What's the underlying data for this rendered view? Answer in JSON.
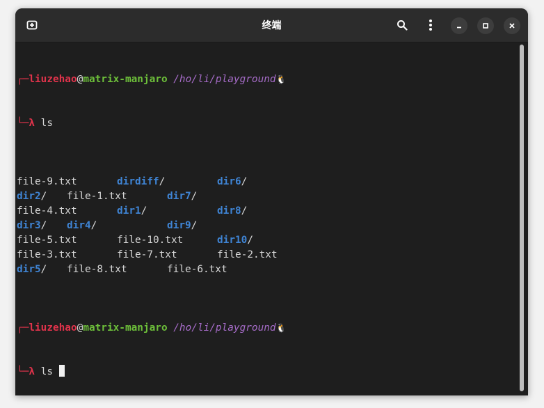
{
  "window": {
    "title": "终端"
  },
  "prompt": {
    "corner_top": "┌─",
    "corner_bottom": "└─",
    "user": "liuzehao",
    "at": "@",
    "host": "matrix-manjaro",
    "path": " /ho/li/playground",
    "penguin": "🐧",
    "lambda": "λ",
    "command": " ls"
  },
  "listing": [
    [
      {
        "text": "file-9.txt",
        "dir": false
      },
      {
        "text": "dirdiff",
        "dir": true
      },
      {
        "text": "dir6",
        "dir": true
      }
    ],
    [
      {
        "text": "dir2",
        "dir": true
      },
      {
        "text": "file-1.txt",
        "dir": false
      },
      {
        "text": "dir7",
        "dir": true
      }
    ],
    [
      {
        "text": "file-4.txt",
        "dir": false
      },
      {
        "text": "dir1",
        "dir": true
      },
      {
        "text": "dir8",
        "dir": true
      }
    ],
    [
      {
        "text": "dir3",
        "dir": true
      },
      {
        "text": "dir4",
        "dir": true
      },
      {
        "text": "dir9",
        "dir": true
      }
    ],
    [
      {
        "text": "file-5.txt",
        "dir": false
      },
      {
        "text": "file-10.txt",
        "dir": false
      },
      {
        "text": "dir10",
        "dir": true
      }
    ],
    [
      {
        "text": "file-3.txt",
        "dir": false
      },
      {
        "text": "file-7.txt",
        "dir": false
      },
      {
        "text": "file-2.txt",
        "dir": false
      }
    ],
    [
      {
        "text": "dir5",
        "dir": true
      },
      {
        "text": "file-8.txt",
        "dir": false
      },
      {
        "text": "file-6.txt",
        "dir": false
      }
    ]
  ],
  "icons": {
    "new_tab": "new-tab-icon",
    "search": "search-icon",
    "menu": "kebab-menu-icon",
    "minimize": "minimize-icon",
    "maximize": "maximize-icon",
    "close": "close-icon"
  },
  "colors": {
    "background": "#1e1e1e",
    "titlebar": "#2c2c2c",
    "user": "#e0334b",
    "host": "#6dbf3a",
    "path": "#a66cc8",
    "directory": "#3f84d4",
    "text": "#d8d8d8"
  }
}
